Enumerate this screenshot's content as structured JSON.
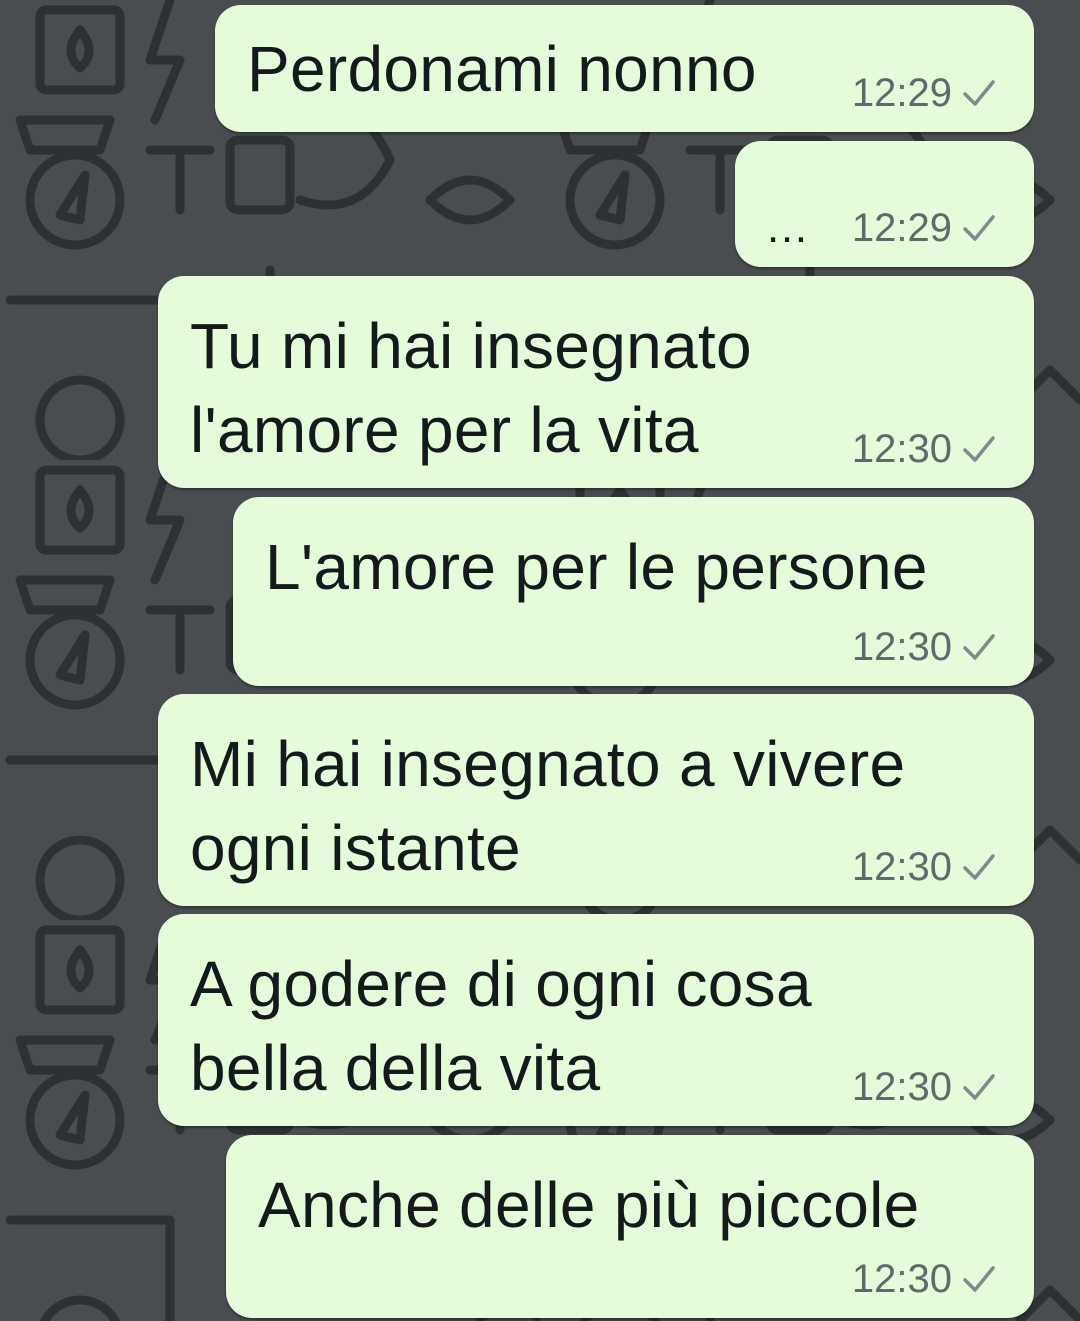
{
  "colors": {
    "wallpaper": "#4a4d50",
    "wallpaper_doodle": "#2e3133",
    "bubble_outgoing": "#e6fbd9",
    "text": "#141a1c",
    "time": "#5f6a6d"
  },
  "messages": [
    {
      "text": "Perdonami nonno",
      "time": "12:29",
      "status_icon": "single-check-icon"
    },
    {
      "text": "…",
      "time": "12:29",
      "status_icon": "single-check-icon"
    },
    {
      "text": "Tu mi hai insegnato\nl'amore per la vita",
      "time": "12:30",
      "status_icon": "single-check-icon"
    },
    {
      "text": "L'amore per le persone",
      "time": "12:30",
      "status_icon": "single-check-icon"
    },
    {
      "text": "Mi hai insegnato a vivere\nogni istante",
      "time": "12:30",
      "status_icon": "single-check-icon"
    },
    {
      "text": "A godere di ogni cosa\nbella della vita",
      "time": "12:30",
      "status_icon": "single-check-icon"
    },
    {
      "text": "Anche delle più piccole",
      "time": "12:30",
      "status_icon": "single-check-icon"
    }
  ]
}
